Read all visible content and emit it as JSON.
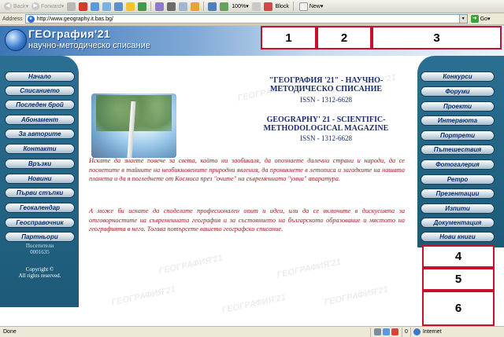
{
  "toolbar": {
    "back": "Back",
    "forward": "Forward",
    "zoom": "100%",
    "block": "Block",
    "new": "New"
  },
  "address": {
    "label": "Address",
    "url": "http://www.geography.it.bas.bg/",
    "go": "Go"
  },
  "banner": {
    "logo_title": "ГЕОграфия'21",
    "logo_subtitle": "научно-методическо списание",
    "markers": [
      "1",
      "2",
      "3"
    ]
  },
  "left_nav": [
    "Начало",
    "Списанието",
    "Последен брой",
    "Абонамент",
    "За авторите",
    "Контакти",
    "Връзки",
    "Новини",
    "Първи стъпки",
    "Геокалендар",
    "Геосправочник",
    "Партньори"
  ],
  "counter": {
    "label": "Посетители",
    "value": "0001635"
  },
  "copyright": {
    "line1": "Copyright ©",
    "line2": "All rights reserved."
  },
  "right_nav": [
    "Конкурси",
    "Форуми",
    "Проекти",
    "Интервюта",
    "Портрети",
    "Пътешествия",
    "Фотогалерия",
    "Ретро",
    "Презентации",
    "Изпити",
    "Документация",
    "Нови книги"
  ],
  "side_markers": [
    "4",
    "5",
    "6"
  ],
  "main": {
    "title_bg": "\"ГЕОГРАФИЯ '21\" - НАУЧНО-МЕТОДИЧЕСКО СПИСАНИЕ",
    "issn_bg": "ISSN - 1312-6628",
    "title_en": "GEOGRAPHY' 21 - SCIENTIFIC-METHODOLOGICAL MAGAZINE",
    "issn_en": "ISSN - 1312-6628",
    "paragraph1": "Искате да знаете повече за света, който ни заобикаля, да опознаете далечни страни и народи, да се посветите в тайните на необикновените природни явления, да проникнете в летописа и загадките на нашата планета и да я погледнете от Космоса през \"очите\" на съвременната \"умна\" апаратура.",
    "paragraph2": "А може би искате да споделите професионален опит и идеи, или да се включите в дискусията за отговорностите на съвременната география и за състоянието на българското образование и мястото на географията в него. Тогава потърсете вашето географско списание.",
    "watermark": "ГЕОГРАФИЯ'21"
  },
  "status": {
    "text": "Done",
    "count": "0",
    "zone": "Internet"
  }
}
